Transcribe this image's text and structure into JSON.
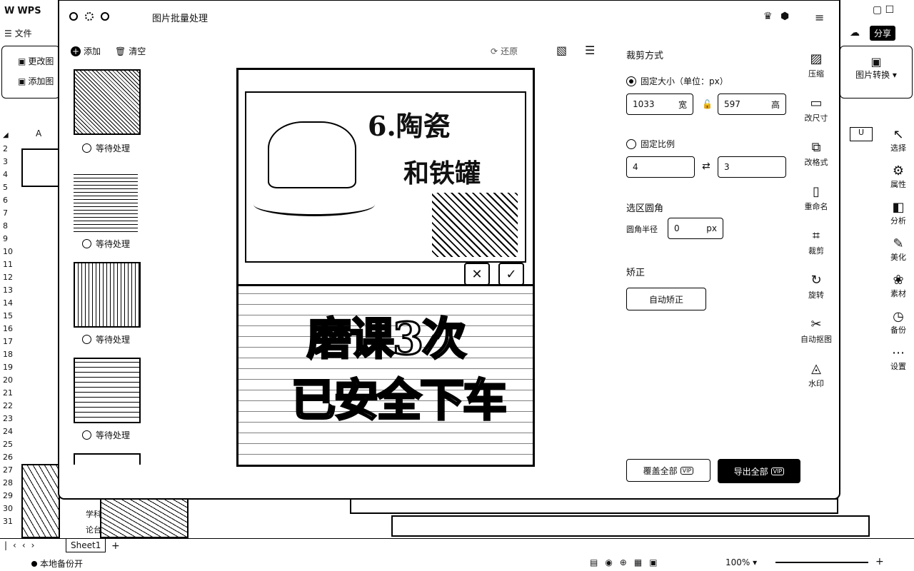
{
  "app": {
    "title": "WPS",
    "menu_file": "文件",
    "ribbon_btn1": "更改图",
    "ribbon_btn2": "添加图",
    "col_a": "A",
    "row_numbers": [
      "2",
      "3",
      "4",
      "5",
      "6",
      "7",
      "8",
      "9",
      "10",
      "11",
      "12",
      "13",
      "14",
      "15",
      "16",
      "17",
      "18",
      "19",
      "20",
      "21",
      "22",
      "23",
      "24",
      "25",
      "26",
      "27",
      "28",
      "29",
      "30",
      "31"
    ],
    "right_ribbon_label": "图片转换",
    "share_label": "分享",
    "right_tools": [
      "选择",
      "属性",
      "分析",
      "美化",
      "素材",
      "备份",
      "设置"
    ],
    "col_u": "U",
    "sheet_tab": "Sheet1",
    "backup_status": "本地备份开",
    "zoom": "100%",
    "cell_text_1": "学科",
    "cell_text_2": "论台"
  },
  "modal": {
    "title": "图片批量处理",
    "toolbar": {
      "add": "添加",
      "clear": "清空",
      "reset": "还原"
    },
    "thumbnails": [
      {
        "status": "等待处理"
      },
      {
        "status": "等待处理"
      },
      {
        "status": "等待处理"
      },
      {
        "status": "等待处理"
      }
    ],
    "preview": {
      "top_text_1": "6.陶瓷",
      "top_text_2": "和铁罐",
      "main_text_1": "磨课3次",
      "main_text_2": "已安全下车"
    },
    "crop": {
      "section_title": "裁剪方式",
      "fixed_size_label": "固定大小（单位：px）",
      "width_value": "1033",
      "width_unit": "宽",
      "height_value": "597",
      "height_unit": "高",
      "fixed_ratio_label": "固定比例",
      "ratio_w": "4",
      "ratio_h": "3",
      "corner_title": "选区圆角",
      "corner_radius_label": "圆角半径",
      "corner_radius_value": "0",
      "corner_unit": "px",
      "correct_title": "矫正",
      "auto_correct": "自动矫正"
    },
    "side_tools": [
      "压缩",
      "改尺寸",
      "改格式",
      "重命名",
      "裁剪",
      "旋转",
      "自动抠图",
      "水印"
    ],
    "footer": {
      "overwrite_all": "覆盖全部",
      "export_all": "导出全部",
      "vip": "VIP"
    }
  }
}
